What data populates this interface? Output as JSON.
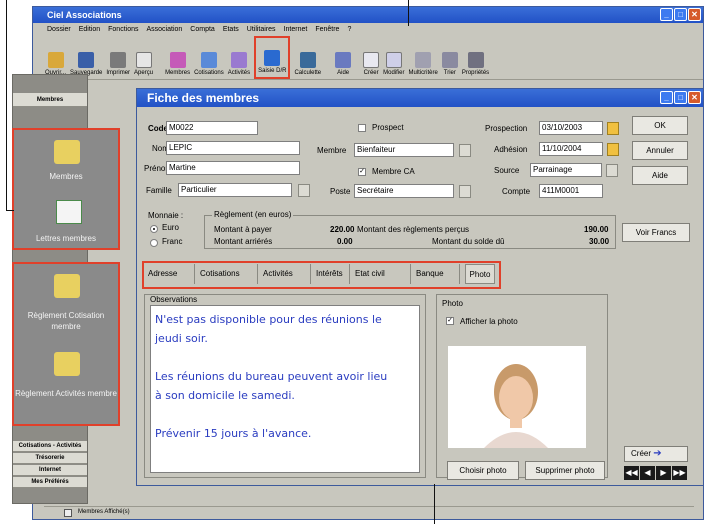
{
  "app": {
    "title": "Ciel Associations",
    "menu": [
      "Dossier",
      "Edition",
      "Fonctions",
      "Association",
      "Compta",
      "Etats",
      "Utilitaires",
      "Internet",
      "Fenêtre",
      "?"
    ],
    "toolbar": [
      "Ouvrir...",
      "Sauvegarde",
      "Imprimer",
      "Aperçu",
      "Membres",
      "Cotisations",
      "Activités",
      "Saisie D/R",
      "Calculette",
      "Aide",
      "Créer",
      "Modifier",
      "Multicritère",
      "Trier",
      "Propriétés"
    ]
  },
  "sidebar": {
    "header": "Membres",
    "callout1": [
      "Membres",
      "Lettres membres"
    ],
    "callout2": [
      "Règlement Cotisation membre",
      "Règlement Activités membre"
    ],
    "bottom_items": [
      "Cotisations - Activités",
      "Trésorerie",
      "Internet",
      "Mes Préférés"
    ]
  },
  "fiche": {
    "title": "Fiche des membres",
    "code_label": "Code",
    "code": "M0022",
    "nom_label": "Nom",
    "nom": "LEPIC",
    "prenom_label": "Prénom",
    "prenom": "Martine",
    "famille_label": "Famille",
    "famille": "Particulier",
    "prospect_label": "Prospect",
    "membre_label": "Membre",
    "membre": "Bienfaiteur",
    "membre_ca_label": "Membre CA",
    "poste_label": "Poste",
    "poste": "Secrétaire",
    "prospection_label": "Prospection",
    "prospection": "03/10/2003",
    "adhesion_label": "Adhésion",
    "adhesion": "11/10/2004",
    "source_label": "Source",
    "source": "Parrainage",
    "compte_label": "Compte",
    "compte": "411M0001",
    "buttons": {
      "ok": "OK",
      "annuler": "Annuler",
      "aide": "Aide",
      "voir_francs": "Voir Francs",
      "creer": "Créer"
    },
    "monnaie": {
      "label": "Monnaie :",
      "euro": "Euro",
      "franc": "Franc"
    },
    "reglement": {
      "label": "Règlement (en euros)",
      "montant_a_payer_label": "Montant à payer",
      "montant_a_payer": "220.00",
      "montant_arrieres_label": "Montant arriérés",
      "montant_arrieres": "0.00",
      "montant_percus_label": "Montant des règlements perçus",
      "montant_percus": "190.00",
      "montant_solde_label": "Montant du solde dû",
      "montant_solde": "30.00"
    },
    "tabs": [
      "Adresse",
      "Cotisations",
      "Activités",
      "Intérêts",
      "Etat civil",
      "Banque",
      "Photo"
    ],
    "observations_label": "Observations",
    "observations": [
      "N'est pas disponible pour des réunions le",
      "jeudi soir.",
      "",
      "Les réunions du bureau peuvent avoir lieu",
      "à son domicile le samedi.",
      "",
      "Prévenir 15 jours à l'avance."
    ],
    "photo": {
      "label": "Photo",
      "afficher": "Afficher la photo",
      "choisir": "Choisir photo",
      "supprimer": "Supprimer photo"
    }
  },
  "statusbar": {
    "text": "Membres Affiché(s)"
  },
  "colors": {
    "accent": "#e0402a",
    "titlebar": "#2251c6",
    "obs_text": "#2a3cc0"
  }
}
